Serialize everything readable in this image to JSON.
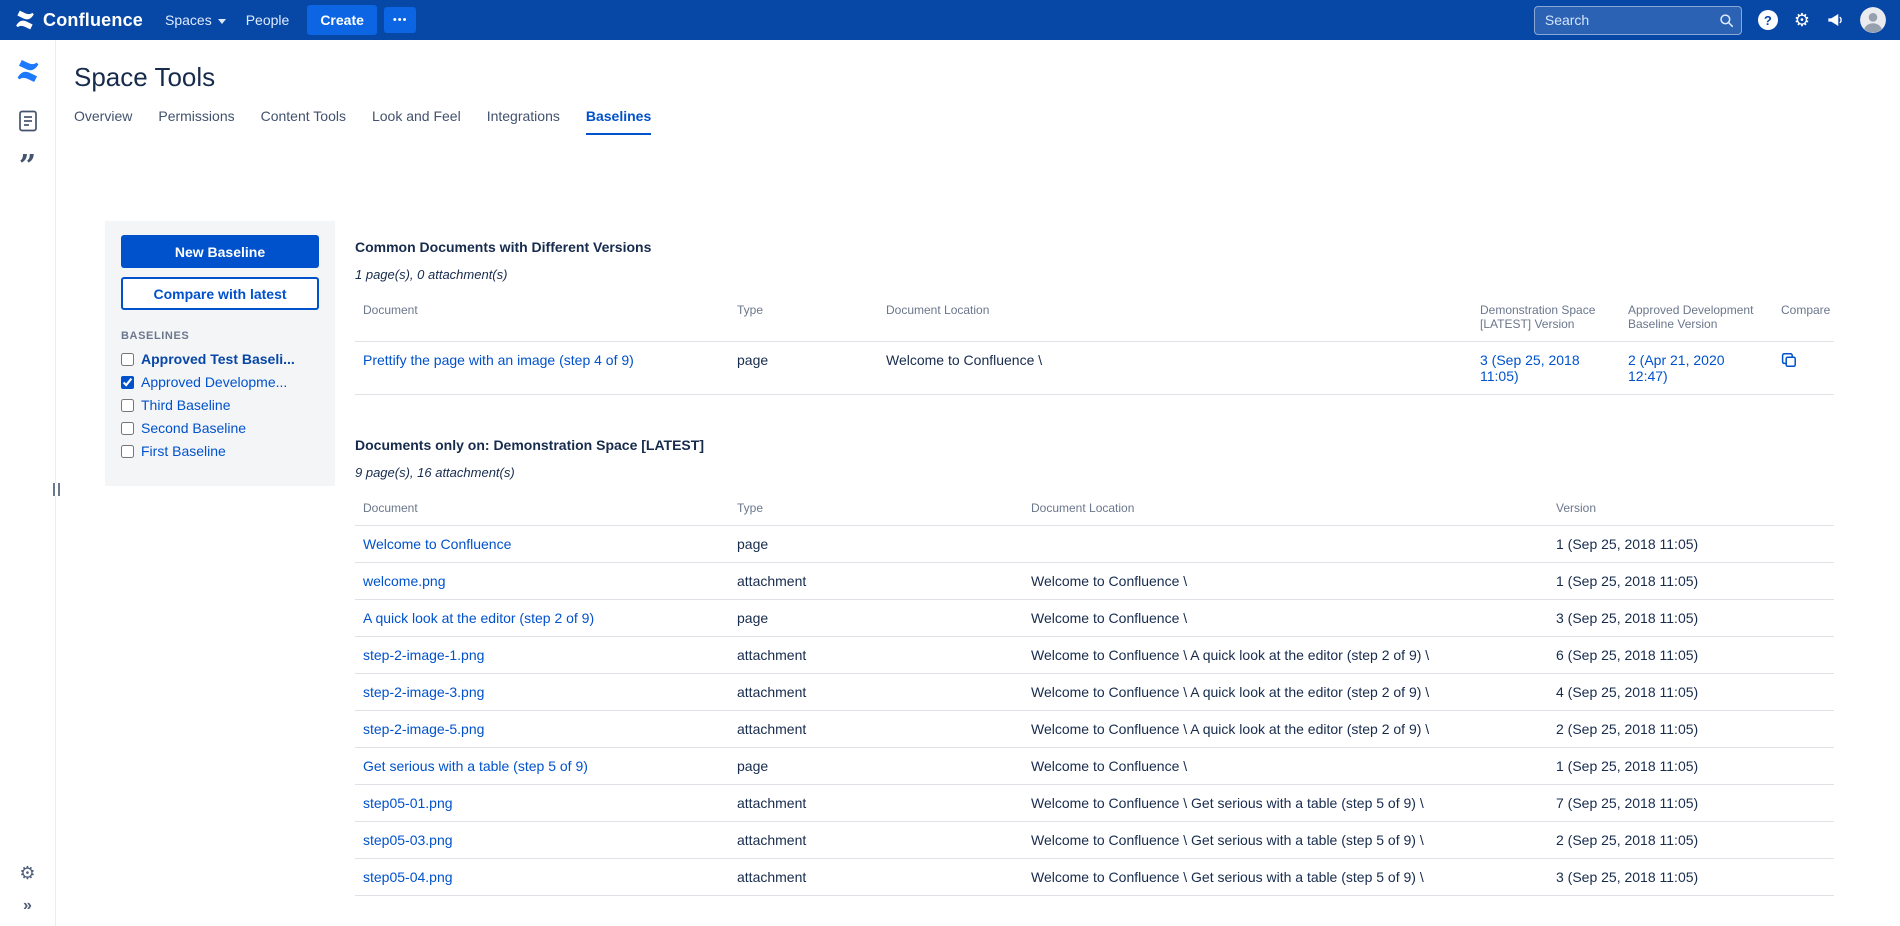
{
  "colors": {
    "navbar_bg": "#0747A6",
    "accent": "#0052CC",
    "create_button_bg": "#0C66E4",
    "panel_bg": "#F4F5F7"
  },
  "navbar": {
    "brand": "Confluence",
    "menu": [
      {
        "label": "Spaces"
      },
      {
        "label": "People"
      }
    ],
    "create_label": "Create",
    "more_label": "•••",
    "search": {
      "placeholder": "Search"
    }
  },
  "page": {
    "title": "Space Tools"
  },
  "tabs": [
    {
      "label": "Overview",
      "active": false
    },
    {
      "label": "Permissions",
      "active": false
    },
    {
      "label": "Content Tools",
      "active": false
    },
    {
      "label": "Look and Feel",
      "active": false
    },
    {
      "label": "Integrations",
      "active": false
    },
    {
      "label": "Baselines",
      "active": true
    }
  ],
  "baseline_panel": {
    "new_button": "New Baseline",
    "compare_button": "Compare with latest",
    "list_label": "BASELINES",
    "items": [
      {
        "label": "Approved Test Baseli...",
        "checked": false,
        "bold": true
      },
      {
        "label": "Approved Developme...",
        "checked": true,
        "bold": false
      },
      {
        "label": "Third Baseline",
        "checked": false,
        "bold": false
      },
      {
        "label": "Second Baseline",
        "checked": false,
        "bold": false
      },
      {
        "label": "First Baseline",
        "checked": false,
        "bold": false
      }
    ]
  },
  "section1": {
    "title": "Common Documents with Different Versions",
    "summary": "1 page(s), 0 attachment(s)",
    "columns": [
      "Document",
      "Type",
      "Document Location",
      "Demonstration Space [LATEST] Version",
      "Approved Development Baseline Version",
      "Compare"
    ],
    "rows": [
      {
        "document": "Prettify the page with an image (step 4 of 9)",
        "type": "page",
        "location": "Welcome to Confluence \\",
        "latest_version": "3 (Sep 25, 2018 11:05)",
        "baseline_version": "2 (Apr 21, 2020 12:47)"
      }
    ]
  },
  "section2": {
    "title": "Documents only on: Demonstration Space [LATEST]",
    "summary": "9 page(s), 16 attachment(s)",
    "columns": [
      "Document",
      "Type",
      "Document Location",
      "Version"
    ],
    "rows": [
      {
        "document": "Welcome to Confluence",
        "type": "page",
        "location": "",
        "version": "1 (Sep 25, 2018 11:05)"
      },
      {
        "document": "welcome.png",
        "type": "attachment",
        "location": "Welcome to Confluence \\",
        "version": "1 (Sep 25, 2018 11:05)"
      },
      {
        "document": "A quick look at the editor (step 2 of 9)",
        "type": "page",
        "location": "Welcome to Confluence \\",
        "version": "3 (Sep 25, 2018 11:05)"
      },
      {
        "document": "step-2-image-1.png",
        "type": "attachment",
        "location": "Welcome to Confluence \\ A quick look at the editor (step 2 of 9) \\",
        "version": "6 (Sep 25, 2018 11:05)"
      },
      {
        "document": "step-2-image-3.png",
        "type": "attachment",
        "location": "Welcome to Confluence \\ A quick look at the editor (step 2 of 9) \\",
        "version": "4 (Sep 25, 2018 11:05)"
      },
      {
        "document": "step-2-image-5.png",
        "type": "attachment",
        "location": "Welcome to Confluence \\ A quick look at the editor (step 2 of 9) \\",
        "version": "2 (Sep 25, 2018 11:05)"
      },
      {
        "document": "Get serious with a table (step 5 of 9)",
        "type": "page",
        "location": "Welcome to Confluence \\",
        "version": "1 (Sep 25, 2018 11:05)"
      },
      {
        "document": "step05-01.png",
        "type": "attachment",
        "location": "Welcome to Confluence \\ Get serious with a table (step 5 of 9) \\",
        "version": "7 (Sep 25, 2018 11:05)"
      },
      {
        "document": "step05-03.png",
        "type": "attachment",
        "location": "Welcome to Confluence \\ Get serious with a table (step 5 of 9) \\",
        "version": "2 (Sep 25, 2018 11:05)"
      },
      {
        "document": "step05-04.png",
        "type": "attachment",
        "location": "Welcome to Confluence \\ Get serious with a table (step 5 of 9) \\",
        "version": "3 (Sep 25, 2018 11:05)"
      }
    ]
  }
}
